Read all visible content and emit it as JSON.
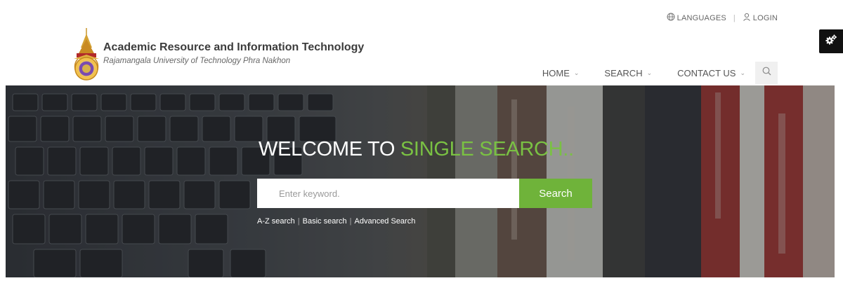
{
  "topbar": {
    "languages_label": "LANGUAGES",
    "login_label": "LOGIN",
    "separator": "|"
  },
  "brand": {
    "title": "Academic Resource and Information Technology",
    "subtitle": "Rajamangala University of Technology Phra Nakhon"
  },
  "nav": {
    "items": [
      {
        "label": "HOME"
      },
      {
        "label": "SEARCH"
      },
      {
        "label": "CONTACT US"
      }
    ],
    "chevron": "⌄"
  },
  "hero": {
    "welcome_prefix": "WELCOME TO ",
    "welcome_accent": "SINGLE SEARCH..",
    "search_placeholder": "Enter keyword.",
    "search_value": "",
    "search_button": "Search",
    "links": [
      {
        "label": "A-Z search"
      },
      {
        "label": "Basic search"
      },
      {
        "label": "Advanced Search"
      }
    ],
    "link_separator": "|"
  },
  "colors": {
    "accent_green": "#7ac143",
    "button_green": "#6fb33a",
    "settings_bg": "#111111"
  },
  "icons": {
    "languages": "globe-icon",
    "login": "user-icon",
    "nav_search": "search-icon",
    "settings": "gears-icon"
  }
}
